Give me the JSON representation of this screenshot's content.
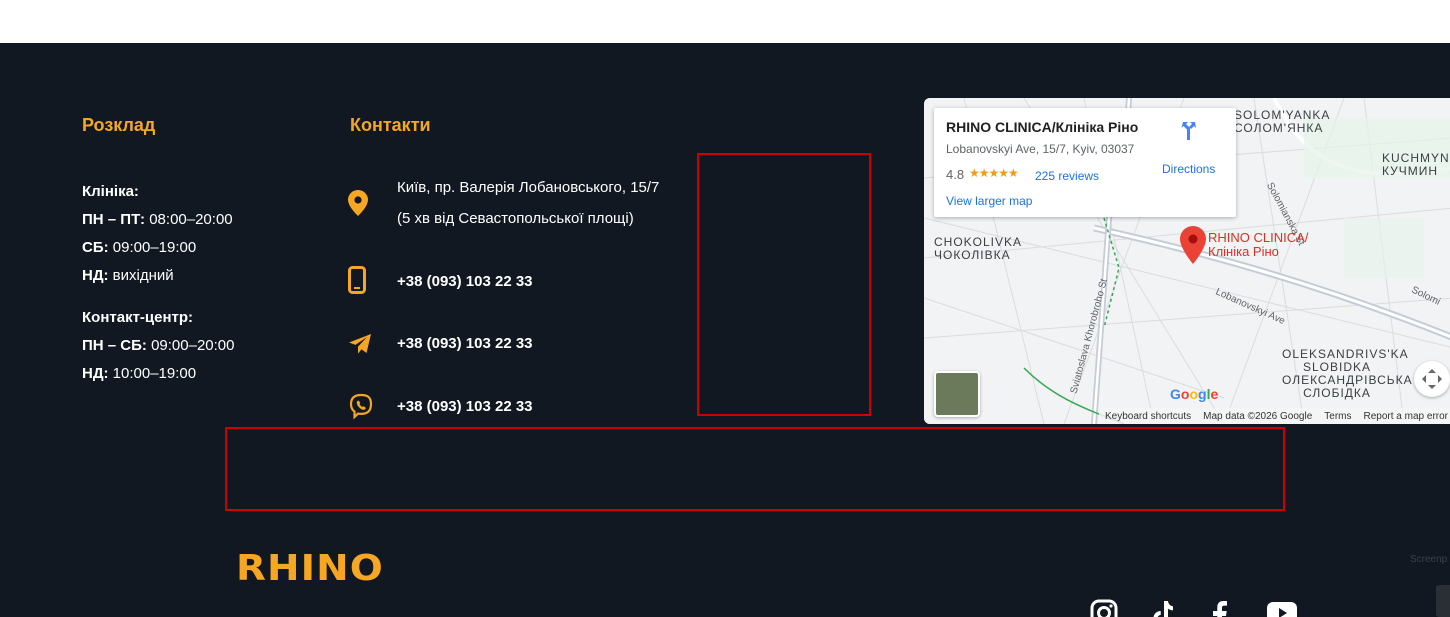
{
  "schedule": {
    "heading": "Розклад",
    "clinic_title": "Клініка:",
    "clinic_lines": [
      {
        "label": "ПН – ПТ:",
        "value": " 08:00–20:00"
      },
      {
        "label": "СБ:",
        "value": " 09:00–19:00"
      },
      {
        "label": "НД:",
        "value": " вихідний"
      }
    ],
    "contact_center_title": "Контакт-центр:",
    "contact_center_lines": [
      {
        "label": "ПН – СБ:",
        "value": " 09:00–20:00"
      },
      {
        "label": "НД:",
        "value": " 10:00–19:00"
      }
    ]
  },
  "contacts": {
    "heading": "Контакти",
    "address_line1": "Київ, пр. Валерія Лобановського, 15/7",
    "address_line2": "(5 хв від Севастопольської площі)",
    "phone": "+38 (093) 103 22 33",
    "telegram": "+38 (093) 103 22 33",
    "viber": "+38 (093) 103 22 33"
  },
  "map": {
    "place_name": "RHINO CLINICA/Клініка Ріно",
    "address": "Lobanovskyi Ave, 15/7, Kyiv, 03037",
    "rating": "4.8",
    "stars": "★★★★★",
    "reviews": "225 reviews",
    "view_larger": "View larger map",
    "directions": "Directions",
    "pin_label_1": "RHINO CLINICA/",
    "pin_label_2": "Клініка Ріно",
    "area_labels": {
      "solomyanka_en": "SOLOM'YANKA",
      "solomyanka_uk": "СОЛОМ'ЯНКА",
      "kuchmyn_en": "KUCHMYN",
      "kuchmyn_uk": "КУЧМИН",
      "chokolivka_en": "CHOKOLIVKA",
      "chokolivka_uk": "ЧОКОЛІВКА",
      "oleksandrivska_en": "OLEKSANDRIVS'KA",
      "oleksandrivska_en2": "SLOBIDKA",
      "oleksandrivska_uk": "ОЛЕКСАНДРІВСЬКА",
      "oleksandrivska_uk2": "СЛОБІДКА"
    },
    "streets": {
      "solomianska": "Solomianska St",
      "lobanovskyi": "Lobanovskyi Ave",
      "khorobroho": "Sviatoslava Khorobroho St",
      "solomi": "Solomi"
    },
    "google": "Google",
    "footer": [
      "Keyboard shortcuts",
      "Map data ©2026 Google",
      "Terms",
      "Report a map error"
    ]
  },
  "logo_text": "RHINO",
  "colors": {
    "accent": "#f5a623",
    "footer_bg": "#111821",
    "highlight": "#cc0000"
  },
  "social_icons": [
    "instagram-icon",
    "tiktok-icon",
    "facebook-icon",
    "youtube-icon"
  ]
}
